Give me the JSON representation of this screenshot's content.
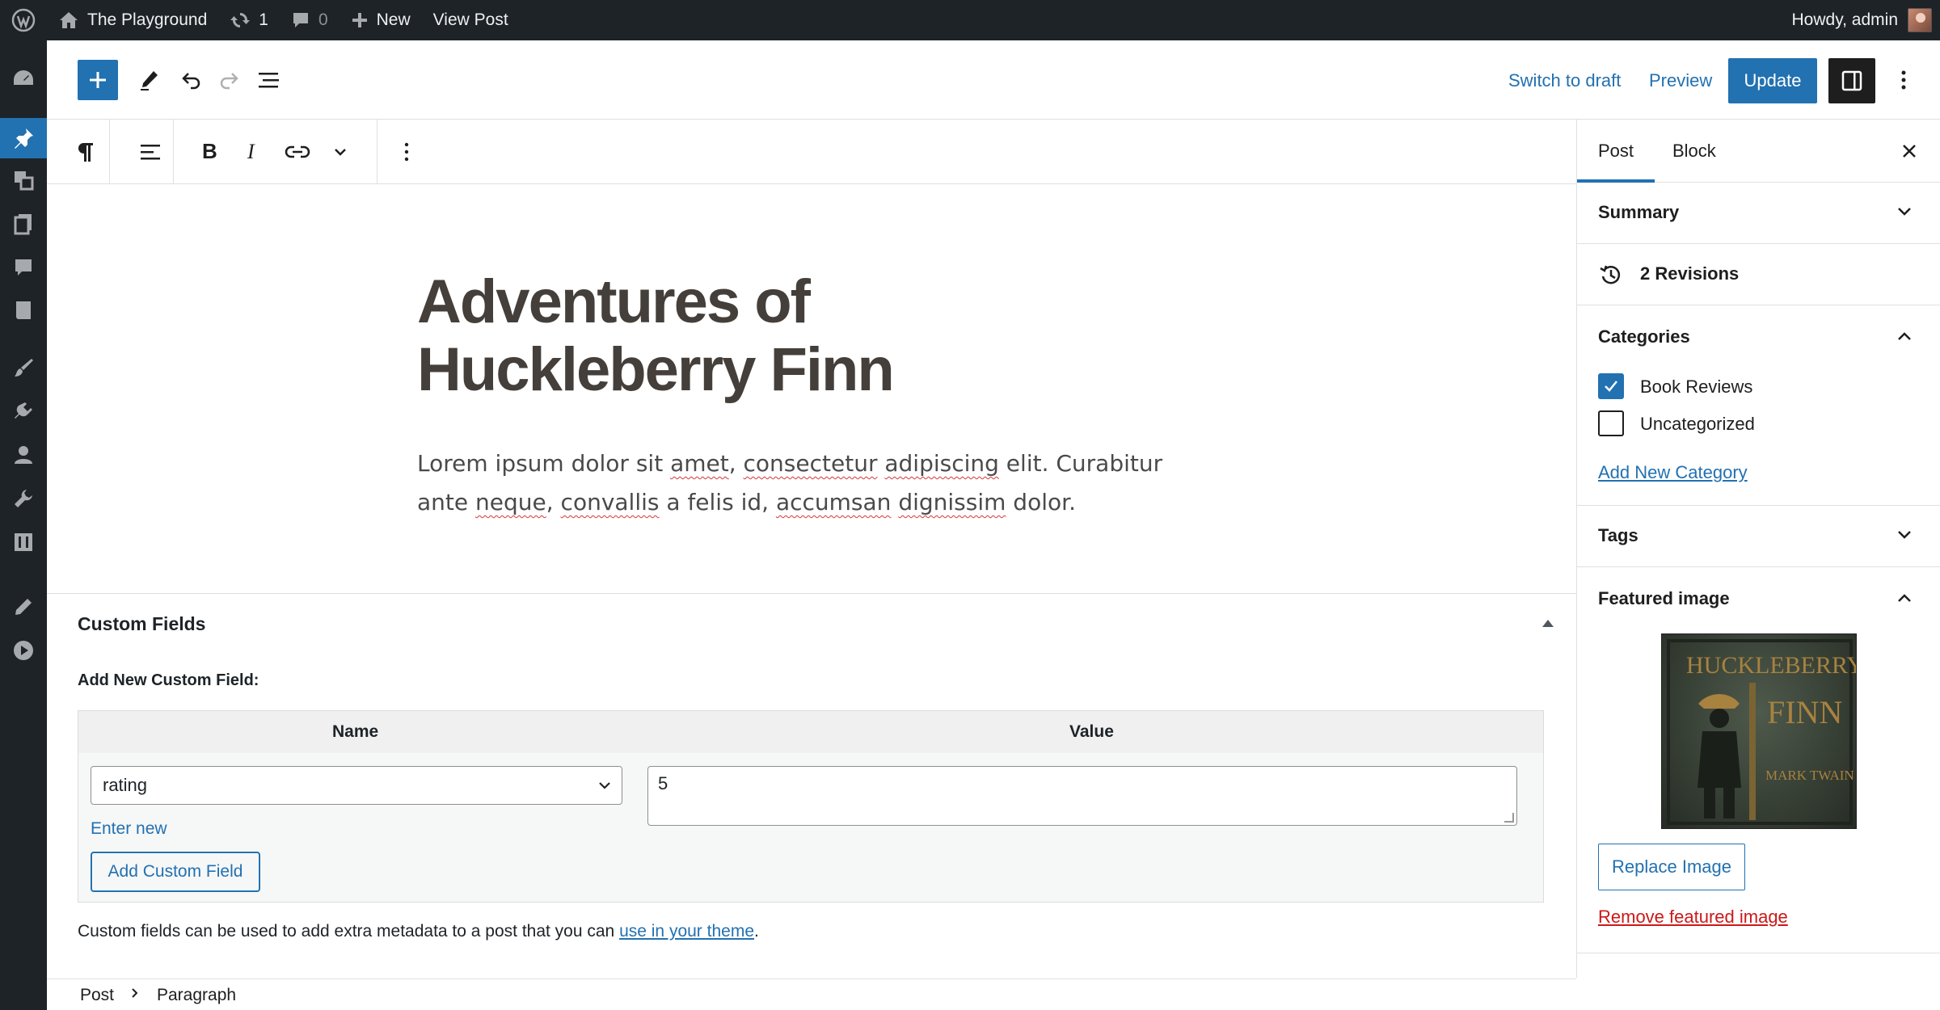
{
  "admin_bar": {
    "site_name": "The Playground",
    "updates_count": "1",
    "comments_count": "0",
    "new_label": "New",
    "view_post_label": "View Post",
    "greeting": "Howdy, admin"
  },
  "header": {
    "switch_to_draft": "Switch to draft",
    "preview": "Preview",
    "update": "Update"
  },
  "post": {
    "title_line1": "Adventures of",
    "title_line2": "Huckleberry Finn",
    "paragraph": "Lorem ipsum dolor sit amet, consectetur adipiscing elit. Curabitur ante neque, convallis a felis id, accumsan dignissim dolor."
  },
  "custom_fields": {
    "title": "Custom Fields",
    "add_new_label": "Add New Custom Field:",
    "col_name": "Name",
    "col_value": "Value",
    "selected_name": "rating",
    "value": "5",
    "enter_new": "Enter new",
    "add_button": "Add Custom Field",
    "note_prefix": "Custom fields can be used to add extra metadata to a post that you can ",
    "note_link": "use in your theme",
    "note_suffix": "."
  },
  "breadcrumb": {
    "root": "Post",
    "current": "Paragraph"
  },
  "sidebar": {
    "tabs": [
      "Post",
      "Block"
    ],
    "summary": "Summary",
    "revisions": "2 Revisions",
    "categories": {
      "title": "Categories",
      "items": [
        {
          "label": "Book Reviews",
          "checked": true
        },
        {
          "label": "Uncategorized",
          "checked": false
        }
      ],
      "add_new": "Add New Category"
    },
    "tags": "Tags",
    "featured_image": {
      "title": "Featured image",
      "image_text_1": "HUCKLEBERRY",
      "image_text_2": "FINN",
      "image_text_3": "MARK TWAIN",
      "replace": "Replace Image",
      "remove": "Remove featured image"
    }
  },
  "colors": {
    "accent": "#2271b1",
    "admin_bar_bg": "#1d2327",
    "danger": "#cc1818"
  }
}
